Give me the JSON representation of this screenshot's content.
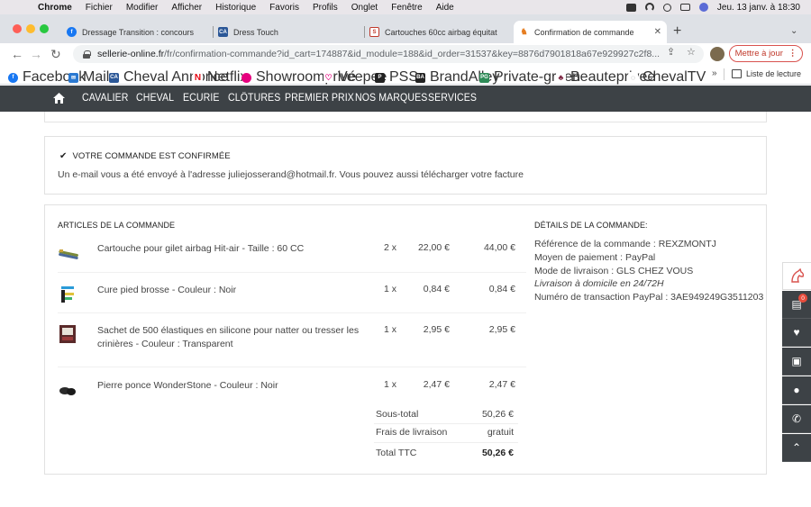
{
  "menubar": {
    "app": "Chrome",
    "items": [
      "Fichier",
      "Modifier",
      "Afficher",
      "Historique",
      "Favoris",
      "Profils",
      "Onglet",
      "Fenêtre",
      "Aide"
    ],
    "datetime": "Jeu. 13 janv. à 18:30"
  },
  "tabs": [
    {
      "title": "Dressage Transition : concours",
      "icon": "facebook-icon",
      "color": "#1877f2"
    },
    {
      "title": "Dress Touch",
      "icon": "ca-icon",
      "color": "#2b5797"
    },
    {
      "title": "Cartouches 60cc airbag équitat",
      "icon": "sellerie-icon",
      "color": "#c0392b"
    },
    {
      "title": "Confirmation de commande",
      "icon": "horse-icon",
      "color": "#e67e22"
    }
  ],
  "toolbar": {
    "url_host": "sellerie-online.fr",
    "url_path": "/fr/confirmation-commande?id_cart=174887&id_module=188&id_order=31537&key=8876d7901818a67e929927c2f8...",
    "update_label": "Mettre à jour"
  },
  "bookmarks": [
    {
      "label": "Facebook",
      "icon": "facebook-icon",
      "color": "#1877f2"
    },
    {
      "label": "Mail",
      "icon": "mail-icon",
      "color": "#2b79d1"
    },
    {
      "label": "Cheval Annonce",
      "icon": "ca-icon",
      "color": "#2b5797"
    },
    {
      "label": "Netflix",
      "icon": "netflix-icon",
      "color": "#e50914"
    },
    {
      "label": "Showroomprivé",
      "icon": "showroom-icon",
      "color": "#e6007e"
    },
    {
      "label": "Veepee",
      "icon": "veepee-icon",
      "color": "#e6007e"
    },
    {
      "label": "PSS",
      "icon": "pss-icon",
      "color": "#222222"
    },
    {
      "label": "BrandAlley",
      "icon": "ba-icon",
      "color": "#222222"
    },
    {
      "label": "Private-green",
      "icon": "pg-icon",
      "color": "#2e8b57"
    },
    {
      "label": "Beauteprivee",
      "icon": "bp-icon",
      "color": "#7a1f3d"
    },
    {
      "label": "ChevalTV",
      "icon": "cheval-tv-icon",
      "color": "#555555"
    }
  ],
  "reading_list": "Liste de lecture",
  "sitenav": [
    "CAVALIER",
    "CHEVAL",
    "ECURIE",
    "CLÔTURES",
    "PREMIER PRIX",
    "NOS MARQUES",
    "SERVICES"
  ],
  "confirmation": {
    "title": "VOTRE COMMANDE EST CONFIRMÉE",
    "message": "Un e-mail vous a été envoyé à l'adresse juliejosserand@hotmail.fr. Vous pouvez aussi télécharger votre facture"
  },
  "order": {
    "items_title": "ARTICLES DE LA COMMANDE",
    "items": [
      {
        "name": "Cartouche pour gilet airbag Hit-air - Taille : 60 CC",
        "qty": "2 x",
        "unit": "22,00 €",
        "total": "44,00 €"
      },
      {
        "name": "Cure pied brosse - Couleur : Noir",
        "qty": "1 x",
        "unit": "0,84 €",
        "total": "0,84 €"
      },
      {
        "name": "Sachet de 500 élastiques en silicone pour natter ou tresser les crinières - Couleur : Transparent",
        "qty": "1 x",
        "unit": "2,95 €",
        "total": "2,95 €"
      },
      {
        "name": "Pierre ponce WonderStone - Couleur : Noir",
        "qty": "1 x",
        "unit": "2,47 €",
        "total": "2,47 €"
      }
    ],
    "subtotal_label": "Sous-total",
    "subtotal": "50,26 €",
    "shipping_label": "Frais de livraison",
    "shipping": "gratuit",
    "total_label": "Total TTC",
    "total": "50,26 €",
    "details_title": "DÉTAILS DE LA COMMANDE:",
    "reference": "Référence de la commande : REXZMONTJ",
    "payment": "Moyen de paiement : PayPal",
    "delivery": "Mode de livraison : GLS CHEZ VOUS",
    "delivery_note": "Livraison à domicile en 24/72H",
    "transaction": "Numéro de transaction PayPal : 3AE949249G3511203"
  },
  "sidebar": {
    "cart_count": "0"
  }
}
